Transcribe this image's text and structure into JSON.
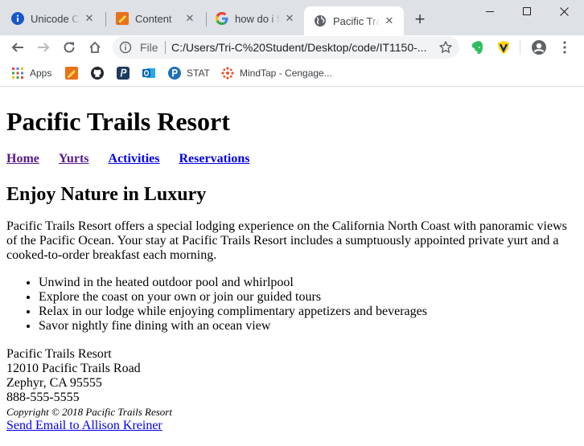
{
  "browser": {
    "tabs": [
      {
        "title": "Unicode Ch",
        "icon": "info-icon",
        "active": false
      },
      {
        "title": "Content",
        "icon": "pencil-doc-icon",
        "active": false
      },
      {
        "title": "how do i fi",
        "icon": "google-icon",
        "active": false
      },
      {
        "title": "Pacific Trai",
        "icon": "globe-icon",
        "active": true
      }
    ],
    "scheme_label": "File",
    "url": "C:/Users/Tri-C%20Student/Desktop/code/IT1150-...",
    "bookmarks": [
      {
        "label": "Apps",
        "icon": "apps-grid-icon"
      },
      {
        "label": "",
        "icon": "pencil-doc-icon"
      },
      {
        "label": "",
        "icon": "github-icon"
      },
      {
        "label": "",
        "icon": "p-square-icon"
      },
      {
        "label": "",
        "icon": "outlook-icon"
      },
      {
        "label": "STAT",
        "icon": "p-circle-icon"
      },
      {
        "label": "MindTap - Cengage...",
        "icon": "mindtap-icon"
      }
    ],
    "colors": {
      "tabstrip": "#dee1e6",
      "omnibox": "#f1f3f4",
      "evernote": "#2dbe60"
    }
  },
  "page": {
    "title": "Pacific Trails Resort",
    "nav": [
      "Home",
      "Yurts",
      "Activities",
      "Reservations"
    ],
    "heading": "Enjoy Nature in Luxury",
    "intro": "Pacific Trails Resort offers a special lodging experience on the California North Coast with panoramic views of the Pacific Ocean. Your stay at Pacific Trails Resort includes a sumptuously appointed private yurt and a cooked-to-order breakfast each morning.",
    "features": [
      "Unwind in the heated outdoor pool and whirlpool",
      "Explore the coast on your own or join our guided tours",
      "Relax in our lodge while enjoying complimentary appetizers and beverages",
      "Savor nightly fine dining with an ocean view"
    ],
    "address": {
      "name": "Pacific Trails Resort",
      "street": "12010 Pacific Trails Road",
      "city": "Zephyr, CA 95555",
      "phone": "888-555-5555"
    },
    "copyright": "Copyright © 2018 Pacific Trails Resort",
    "email_link": "Send Email to Allison Kreiner"
  }
}
